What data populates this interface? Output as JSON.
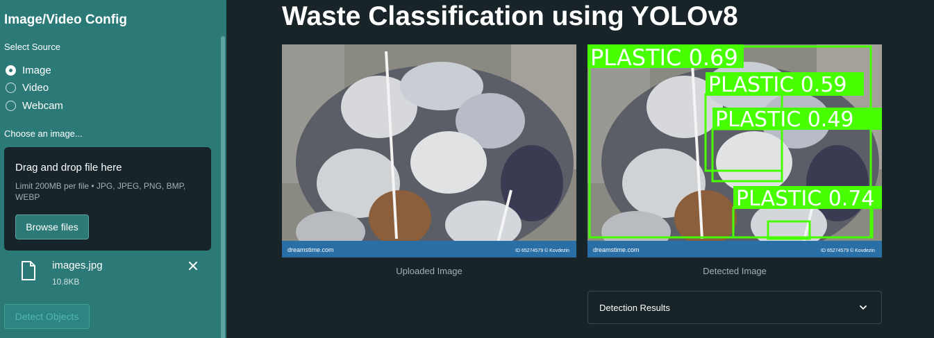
{
  "sidebar": {
    "title": "Image/Video Config",
    "source_label": "Select Source",
    "sources": [
      {
        "label": "Image",
        "checked": true
      },
      {
        "label": "Video",
        "checked": false
      },
      {
        "label": "Webcam",
        "checked": false
      }
    ],
    "choose_label": "Choose an image...",
    "dropzone": {
      "title": "Drag and drop file here",
      "hint": "Limit 200MB per file • JPG, JPEG, PNG, BMP, WEBP",
      "browse_label": "Browse files"
    },
    "file": {
      "name": "images.jpg",
      "size": "10.8KB",
      "icon": "file-icon"
    },
    "detect_label": "Detect Objects"
  },
  "main": {
    "title": "Waste Classification using YOLOv8",
    "uploaded_caption": "Uploaded Image",
    "detected_caption": "Detected Image",
    "watermark_left": "dreamstime.com",
    "watermark_right": "ID 65274579 © Kovdezin",
    "detections": [
      {
        "label": "PLASTIC 0.69"
      },
      {
        "label": "PLASTIC 0.59"
      },
      {
        "label": "PLASTIC 0.49"
      },
      {
        "label": "PLASTIC 0.74"
      }
    ],
    "results_label": "Detection Results"
  },
  "colors": {
    "sidebar_bg": "#2b7a78",
    "main_bg": "#182428",
    "dropzone_bg": "#17252a",
    "detection_box": "#47ff00"
  }
}
